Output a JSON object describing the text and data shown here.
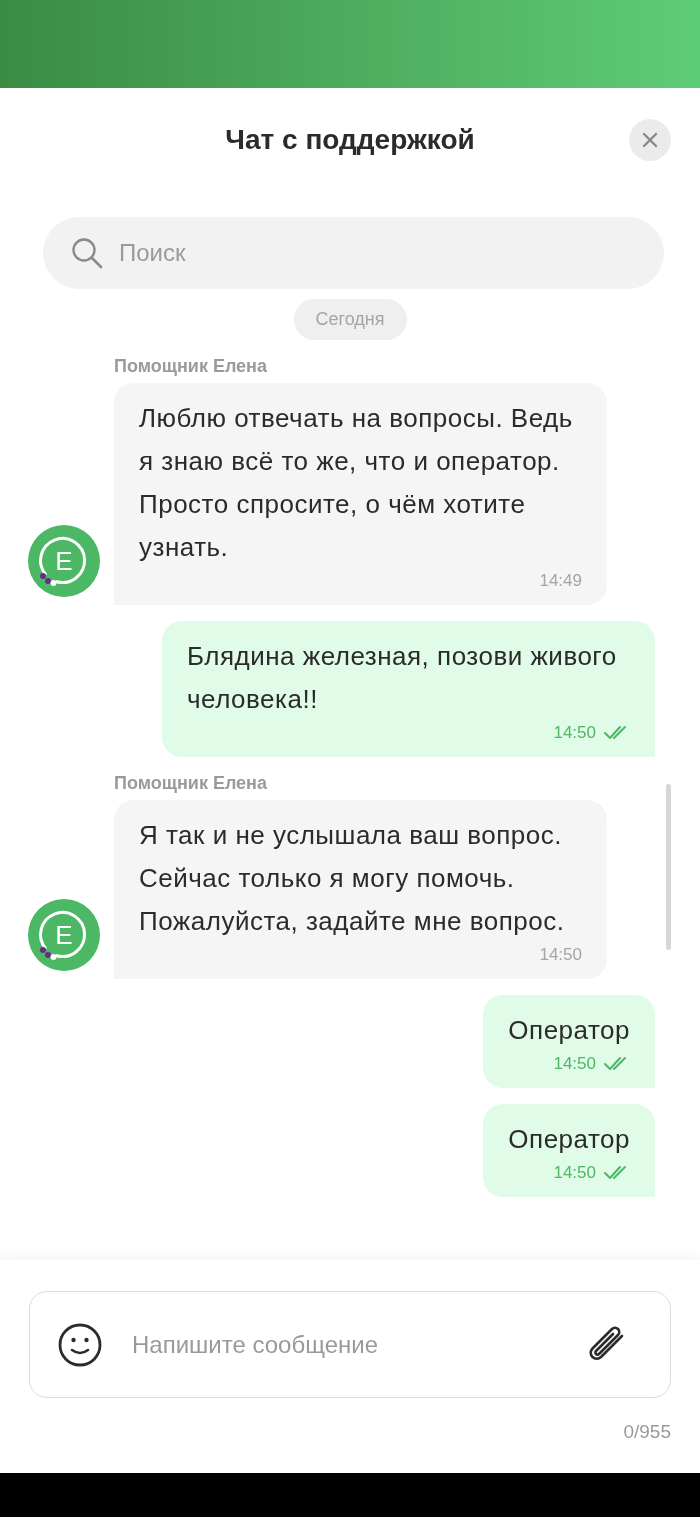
{
  "header": {
    "title": "Чат с поддержкой"
  },
  "search": {
    "placeholder": "Поиск"
  },
  "date_separator": "Сегодня",
  "messages": [
    {
      "kind": "incoming",
      "sender": "Помощник Елена",
      "avatar_letter": "Е",
      "text": "Люблю отвечать на вопросы. Ведь я знаю всё то же, что и оператор. Просто спросите, о чём хотите узнать.",
      "time": "14:49"
    },
    {
      "kind": "outgoing",
      "text": "Блядина железная, позови живого человека!!",
      "time": "14:50",
      "read": true
    },
    {
      "kind": "incoming",
      "sender": "Помощник Елена",
      "avatar_letter": "Е",
      "text": "Я так и не услышала ваш вопрос. Сейчас только я могу помочь. Пожалуйста, задайте мне вопрос.",
      "time": "14:50"
    },
    {
      "kind": "outgoing",
      "text": "Оператор",
      "time": "14:50",
      "read": true
    },
    {
      "kind": "outgoing",
      "text": "Оператор",
      "time": "14:50",
      "read": true
    }
  ],
  "composer": {
    "placeholder": "Напишите сообщение",
    "counter": "0/955"
  }
}
